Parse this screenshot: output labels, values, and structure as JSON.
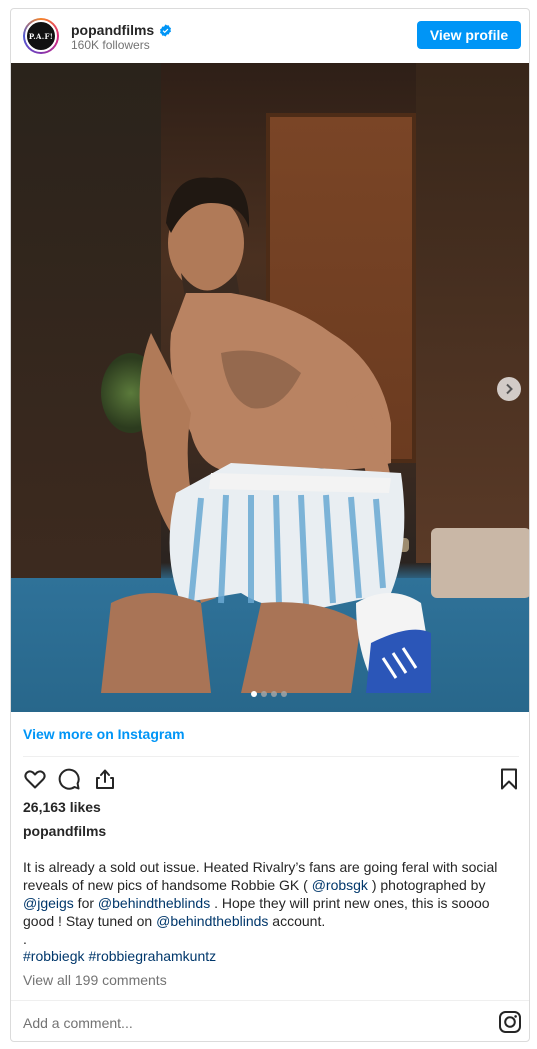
{
  "header": {
    "avatar_text": "P.A.F!",
    "username": "popandfilms",
    "followers": "160K followers",
    "view_profile": "View profile"
  },
  "carousel": {
    "slides": 4,
    "active": 1
  },
  "view_more": "View more on Instagram",
  "likes": "26,163 likes",
  "author": "popandfilms",
  "caption": {
    "t1": "It is already a sold out issue. Heated Rivalry’s fans are going feral with social reveals of new pics of handsome Robbie GK ( ",
    "m1": "@robsgk",
    "t2": " ) photographed by ",
    "m2": "@jgeigs",
    "t3": " for ",
    "m3": "@behindtheblinds",
    "t4": " . Hope they will print new ones, this is soooo good ! Stay tuned on ",
    "m4": "@behindtheblinds",
    "t5": " account.",
    "dot": "."
  },
  "tags": [
    "#robbiegk",
    "#robbiegrahamkuntz"
  ],
  "view_comments": "View all 199 comments",
  "add_comment": "Add a comment...",
  "colors": {
    "accent": "#0095f6",
    "link": "#00376b",
    "muted": "#737373"
  }
}
